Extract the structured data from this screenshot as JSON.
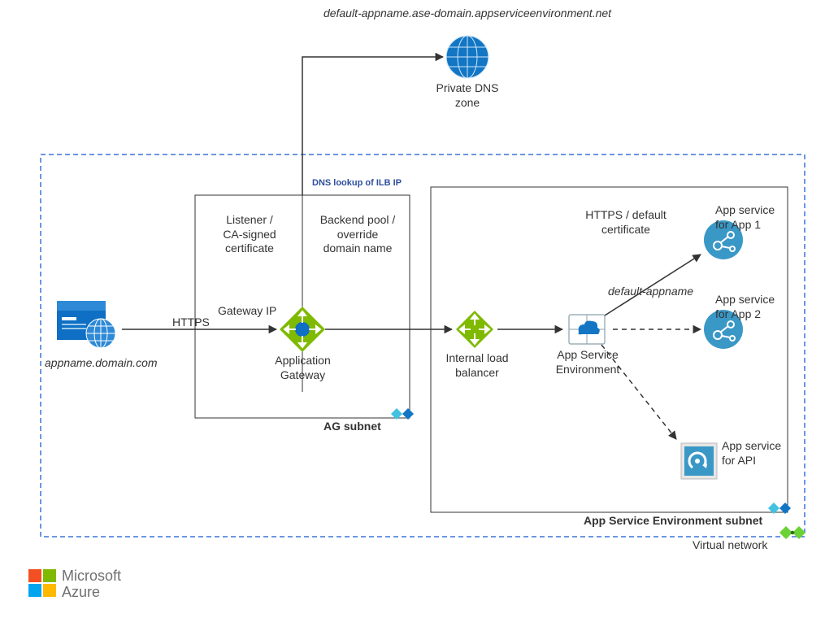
{
  "labels": {
    "dnsDomain": "default-appname.ase-domain.appserviceenvironment.net",
    "privateDns": "Private DNS\nzone",
    "dnsLookup": "DNS lookup of ILB IP",
    "listener": "Listener /\nCA-signed\ncertificate",
    "backendPool": "Backend pool /\noverride\ndomain name",
    "gatewayIp": "Gateway IP",
    "appGateway": "Application\nGateway",
    "https": "HTTPS",
    "appDomain": "appname.domain.com",
    "ilb": "Internal load\nbalancer",
    "ase": "App Service\nEnvironment",
    "httpsDefault": "HTTPS / default\ncertificate",
    "defaultAppname": "default-appname",
    "app1": "App service\nfor App 1",
    "app2": "App service\nfor App 2",
    "appApi": "App service\nfor API",
    "agSubnet": "AG subnet",
    "aseSubnet": "App Service Environment subnet",
    "vnet": "Virtual network",
    "ms": "Microsoft",
    "az": "Azure"
  },
  "colors": {
    "azure": "#0072C6",
    "green": "#7fba00",
    "cyan": "#3a98c7",
    "blue": "#0e6fc4"
  }
}
